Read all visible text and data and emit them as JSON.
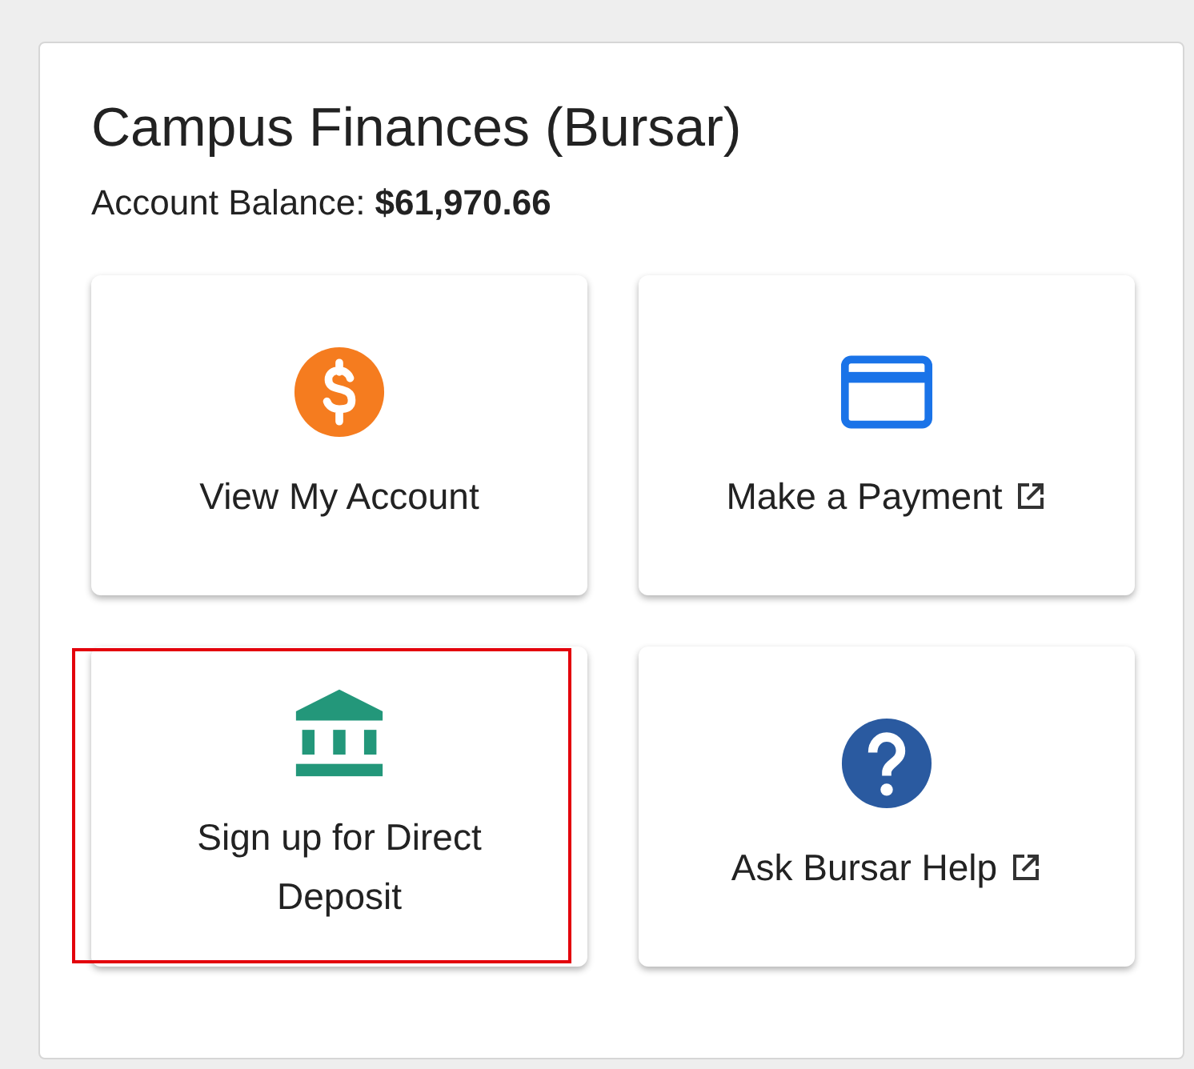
{
  "card": {
    "title": "Campus Finances (Bursar)",
    "balance_label": "Account Balance:",
    "balance_value": "$61,970.66"
  },
  "tiles": [
    {
      "label": "View My Account",
      "kind": "dollar",
      "external": false,
      "highlighted": false
    },
    {
      "label": "Make a Payment",
      "kind": "card",
      "external": true,
      "highlighted": false
    },
    {
      "label": "Sign up for Direct Deposit",
      "kind": "bank",
      "external": false,
      "highlighted": true
    },
    {
      "label": "Ask Bursar Help",
      "kind": "help",
      "external": true,
      "highlighted": false
    }
  ]
}
